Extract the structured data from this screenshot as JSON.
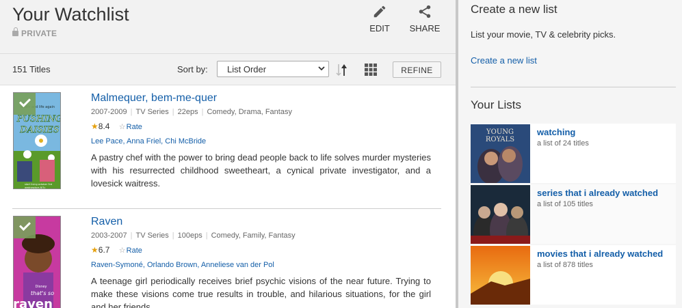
{
  "header": {
    "title": "Your Watchlist",
    "privacy": "PRIVATE",
    "edit_label": "EDIT",
    "share_label": "SHARE"
  },
  "toolbar": {
    "count": "151 Titles",
    "sort_label": "Sort by:",
    "sort_value": "List Order",
    "refine_label": "REFINE"
  },
  "items": [
    {
      "title": "Malmequer, bem-me-quer",
      "years": "2007-2009",
      "type": "TV Series",
      "episodes": "22eps",
      "genres": "Comedy, Drama, Fantasy",
      "rating": "8.4",
      "rate_label": "Rate",
      "cast": [
        "Lee Pace",
        "Anna Friel",
        "Chi McBride"
      ],
      "plot": "A pastry chef with the power to bring dead people back to life solves murder mysteries with his resurrected childhood sweetheart, a cynical private investigator, and a lovesick waitress.",
      "poster_text": [
        "death and life again",
        "PUSHING",
        "DAISIES",
        "start living october 3rd",
        "wednesdays 8/7c"
      ]
    },
    {
      "title": "Raven",
      "years": "2003-2007",
      "type": "TV Series",
      "episodes": "100eps",
      "genres": "Comedy, Family, Fantasy",
      "rating": "6.7",
      "rate_label": "Rate",
      "cast": [
        "Raven-Symoné",
        "Orlando Brown",
        "Anneliese van der Pol"
      ],
      "plot": "A teenage girl periodically receives brief psychic visions of the near future. Trying to make these visions come true results in trouble, and hilarious situations, for the girl and her friends.",
      "poster_text": [
        "Disney",
        "that's so",
        "raven"
      ]
    }
  ],
  "sidebar": {
    "create_heading": "Create a new list",
    "create_desc": "List your movie, TV & celebrity picks.",
    "create_link": "Create a new list",
    "lists_heading": "Your Lists",
    "lists": [
      {
        "name": "watching",
        "count": "a list of 24 titles",
        "thumb_text": [
          "YOUNG",
          "ROYALS"
        ]
      },
      {
        "name": "series that i already watched",
        "count": "a list of 105 titles"
      },
      {
        "name": "movies that i already watched",
        "count": "a list of 878 titles"
      }
    ]
  },
  "colors": {
    "link": "#135ea8",
    "star": "#e5a00d",
    "header_bg": "#f2f2f2",
    "check": "#78a05a"
  }
}
